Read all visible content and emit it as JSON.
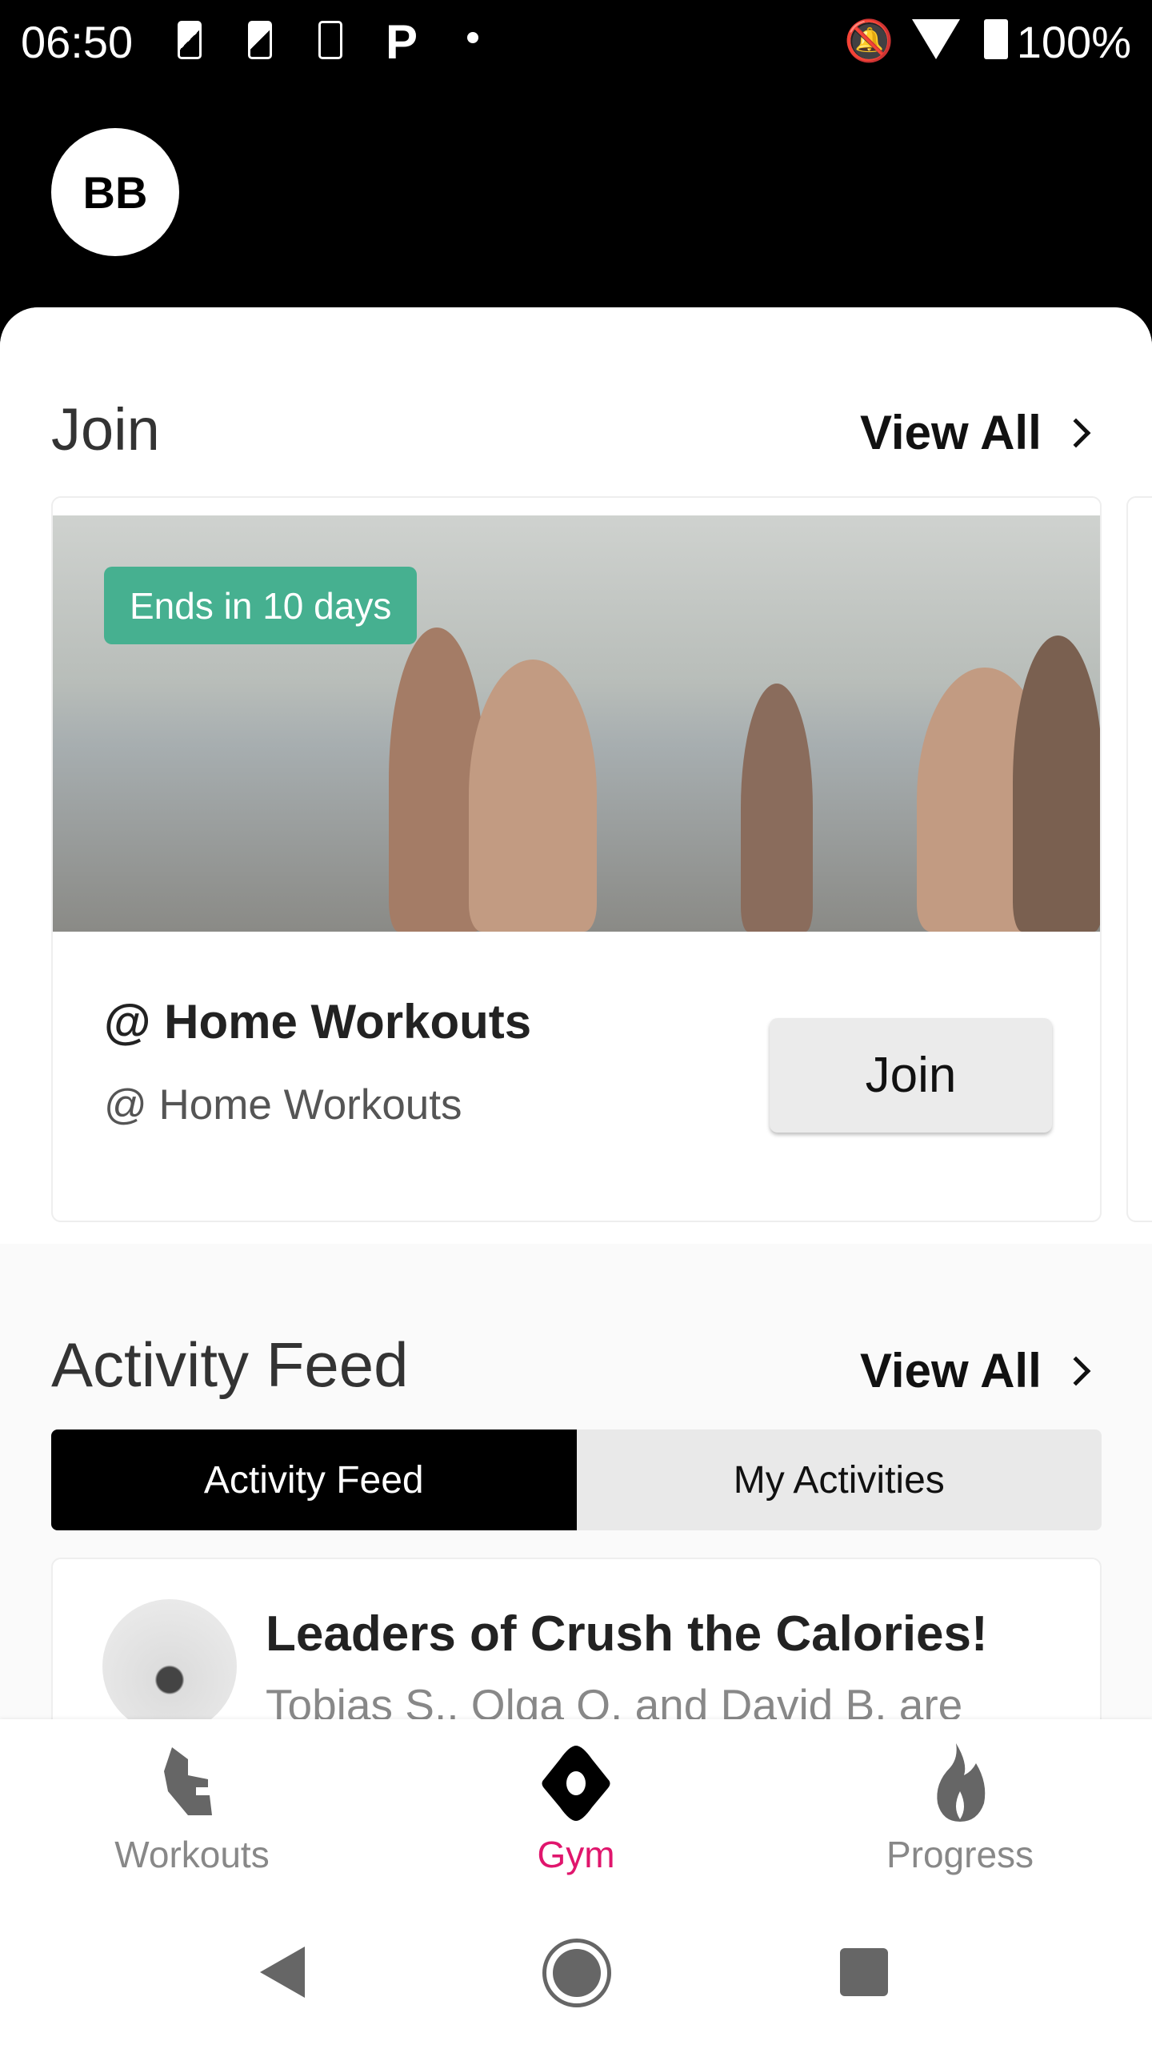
{
  "status_bar": {
    "time": "06:50",
    "battery": "100%",
    "icons": [
      "sim-icon",
      "sim-icon",
      "task-icon",
      "parking-icon",
      "dot-icon",
      "bell-off-icon",
      "wifi-icon",
      "battery-icon"
    ]
  },
  "header": {
    "avatar_initials": "BB"
  },
  "join_section": {
    "title": "Join",
    "view_all": "View All",
    "card": {
      "badge": "Ends in 10 days",
      "title": "@ Home Workouts",
      "subtitle": "@ Home Workouts",
      "button": "Join"
    }
  },
  "activity_section": {
    "title": "Activity Feed",
    "view_all": "View All",
    "tabs": [
      {
        "label": "Activity Feed",
        "active": true
      },
      {
        "label": "My Activities",
        "active": false
      }
    ],
    "item": {
      "title": "Leaders of Crush the Calories!",
      "text": "Tobias S., Olga O. and David B. are"
    }
  },
  "bottom_nav": {
    "items": [
      {
        "label": "Workouts",
        "icon": "shoe-icon"
      },
      {
        "label": "Gym",
        "icon": "gym-icon",
        "active": true
      },
      {
        "label": "Progress",
        "icon": "flame-icon"
      }
    ],
    "active_color": "#e0166d"
  },
  "colors": {
    "badge": "#46b090",
    "active_tab": "#000000"
  }
}
